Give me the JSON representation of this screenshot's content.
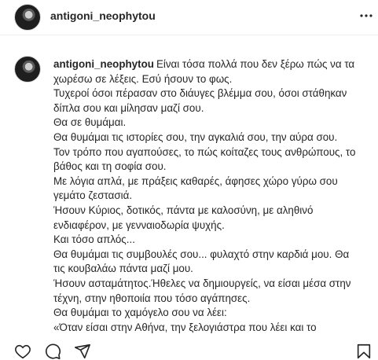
{
  "post": {
    "username": "antigoni_neophytou"
  },
  "caption": {
    "username": "antigoni_neophytou",
    "first_line": "Είναι τόσα πολλά που δεν ξέρω πώς να τα",
    "lines": [
      "χωρέσω σε λέξεις. Εσύ ήσουν το φως.",
      "Τυχεροί όσοι πέρασαν στο διάυγες βλέμμα σου, όσοι στάθηκαν",
      "δίπλα σου και μίλησαν μαζί σου.",
      "Θα σε θυμάμαι.",
      "Θα θυμάμαι τις ιστορίες σου, την αγκαλιά σου, την αύρα σου.",
      "Τον τρόπο που αγαπούσες, το πώς κοίταζες τους ανθρώπους, το",
      "βάθος και τη σοφία σου.",
      "Με λόγια απλά, με πράξεις καθαρές, άφησες χώρο γύρω σου",
      "γεμάτο ζεστασιά.",
      "Ήσουν Κύριος, δοτικός, πάντα με καλοσύνη, με αληθινό",
      "ενδιαφέρον, με γενναιοδωρία ψυχής.",
      "Και τόσο απλός...",
      "Θα θυμάμαι τις συμβουλές σου... φυλαχτό στην καρδιά μου. Θα",
      "τις κουβαλάω πάντα μαζί μου.",
      "Ήσουν ασταμάτητος.Ήθελες να δημιουργείς, να είσαι μέσα στην",
      "τέχνη, στην ηθοποιία που τόσο αγάπησες.",
      "Θα θυμάμαι το χαμόγελο σου να λέει:",
      "«Όταν είσαι στην Αθήνα, την ξελογιάστρα που λέει και το"
    ]
  },
  "icons": {
    "more": "more-horizontal-icon",
    "like": "heart-icon",
    "comment": "comment-icon",
    "share": "share-icon",
    "save": "bookmark-icon"
  }
}
